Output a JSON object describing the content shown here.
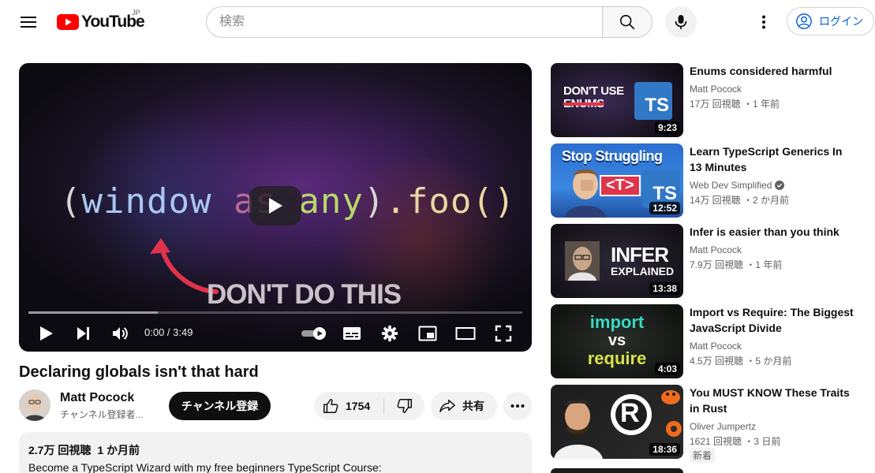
{
  "masthead": {
    "logo_text": "YouTube",
    "region": "JP",
    "search_placeholder": "検索",
    "signin_label": "ログイン"
  },
  "player": {
    "code_parts": [
      "(",
      "window",
      " as",
      " any",
      ")",
      ".foo()"
    ],
    "overlay_caption": "DON'T DO THIS",
    "time_current": "0:00",
    "time_total": "3:49",
    "time_display": "0:00 / 3:49",
    "progress_fraction": 0.262
  },
  "video": {
    "title": "Declaring globals isn't that hard",
    "channel_name": "Matt Pocock",
    "subscriber_text": "チャンネル登録者...",
    "subscribe_label": "チャンネル登録",
    "like_count": "1754",
    "share_label": "共有",
    "views": "2.7万 回視聴",
    "age": "1 か月前",
    "description_line": "Become a TypeScript Wizard with my free beginners TypeScript Course:"
  },
  "recommendations": [
    {
      "title": "Enums considered harmful",
      "channel": "Matt Pocock",
      "verified": false,
      "meta": "17万 回視聴 ・1 年前",
      "duration": "9:23",
      "thumb_text": [
        "DON'T USE",
        "ENUMS"
      ],
      "thumb_badge": "TS",
      "new": false
    },
    {
      "title": "Learn TypeScript Generics In 13 Minutes",
      "channel": "Web Dev Simplified",
      "verified": true,
      "meta": "14万 回視聴 ・2 か月前",
      "duration": "12:52",
      "thumb_text": [
        "Stop Struggling",
        "<T>"
      ],
      "thumb_badge": "TS",
      "new": false
    },
    {
      "title": "Infer is easier than you think",
      "channel": "Matt Pocock",
      "verified": false,
      "meta": "7.9万 回視聴 ・1 年前",
      "duration": "13:38",
      "thumb_text": [
        "INFER",
        "EXPLAINED"
      ],
      "new": false
    },
    {
      "title": "Import vs Require: The Biggest JavaScript Divide",
      "channel": "Matt Pocock",
      "verified": false,
      "meta": "4.5万 回視聴 ・5 か月前",
      "duration": "4:03",
      "thumb_text": [
        "import",
        "vs",
        "require"
      ],
      "new": false
    },
    {
      "title": "You MUST KNOW These Traits in Rust",
      "channel": "Oliver Jumpertz",
      "verified": false,
      "meta": "1621 回視聴 ・3 日前",
      "duration": "18:36",
      "thumb_text": [
        "R"
      ],
      "new": true,
      "new_label": "新着"
    }
  ],
  "colors": {
    "brand_red": "#ff0000",
    "link_blue": "#065fd4",
    "ts_blue": "#3178c6"
  }
}
